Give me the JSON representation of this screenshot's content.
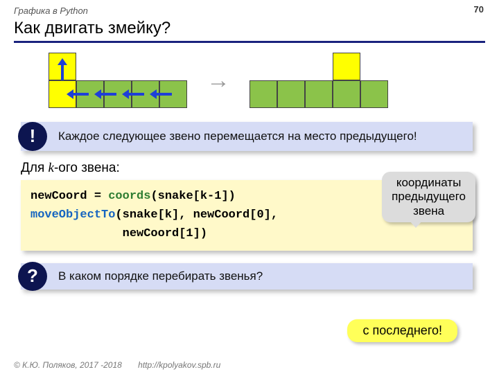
{
  "header": {
    "topic": "Графика в Python",
    "page": "70"
  },
  "title": "Как двигать змейку?",
  "diagram": {
    "big_arrow": "→"
  },
  "callout1": {
    "badge": "!",
    "text": "Каждое следующее звено перемещается на место предыдущего!"
  },
  "line": {
    "prefix": "Для ",
    "k": "k",
    "suffix": "-ого звена:"
  },
  "code": {
    "l1a": "newCoord = ",
    "l1b": "coords",
    "l1c": "(snake[k-1])",
    "l2a": "moveObjectTo",
    "l2b": "(snake[k], newCoord[0],",
    "l3": "             newCoord[1])"
  },
  "note": {
    "l1": "координаты",
    "l2": "предыдущего",
    "l3": "звена"
  },
  "callout2": {
    "badge": "?",
    "text": "В каком порядке перебирать звенья?"
  },
  "answer": "с последнего!",
  "footer": {
    "copy": "© К.Ю. Поляков, 2017 -2018",
    "url": "http://kpolyakov.spb.ru"
  }
}
